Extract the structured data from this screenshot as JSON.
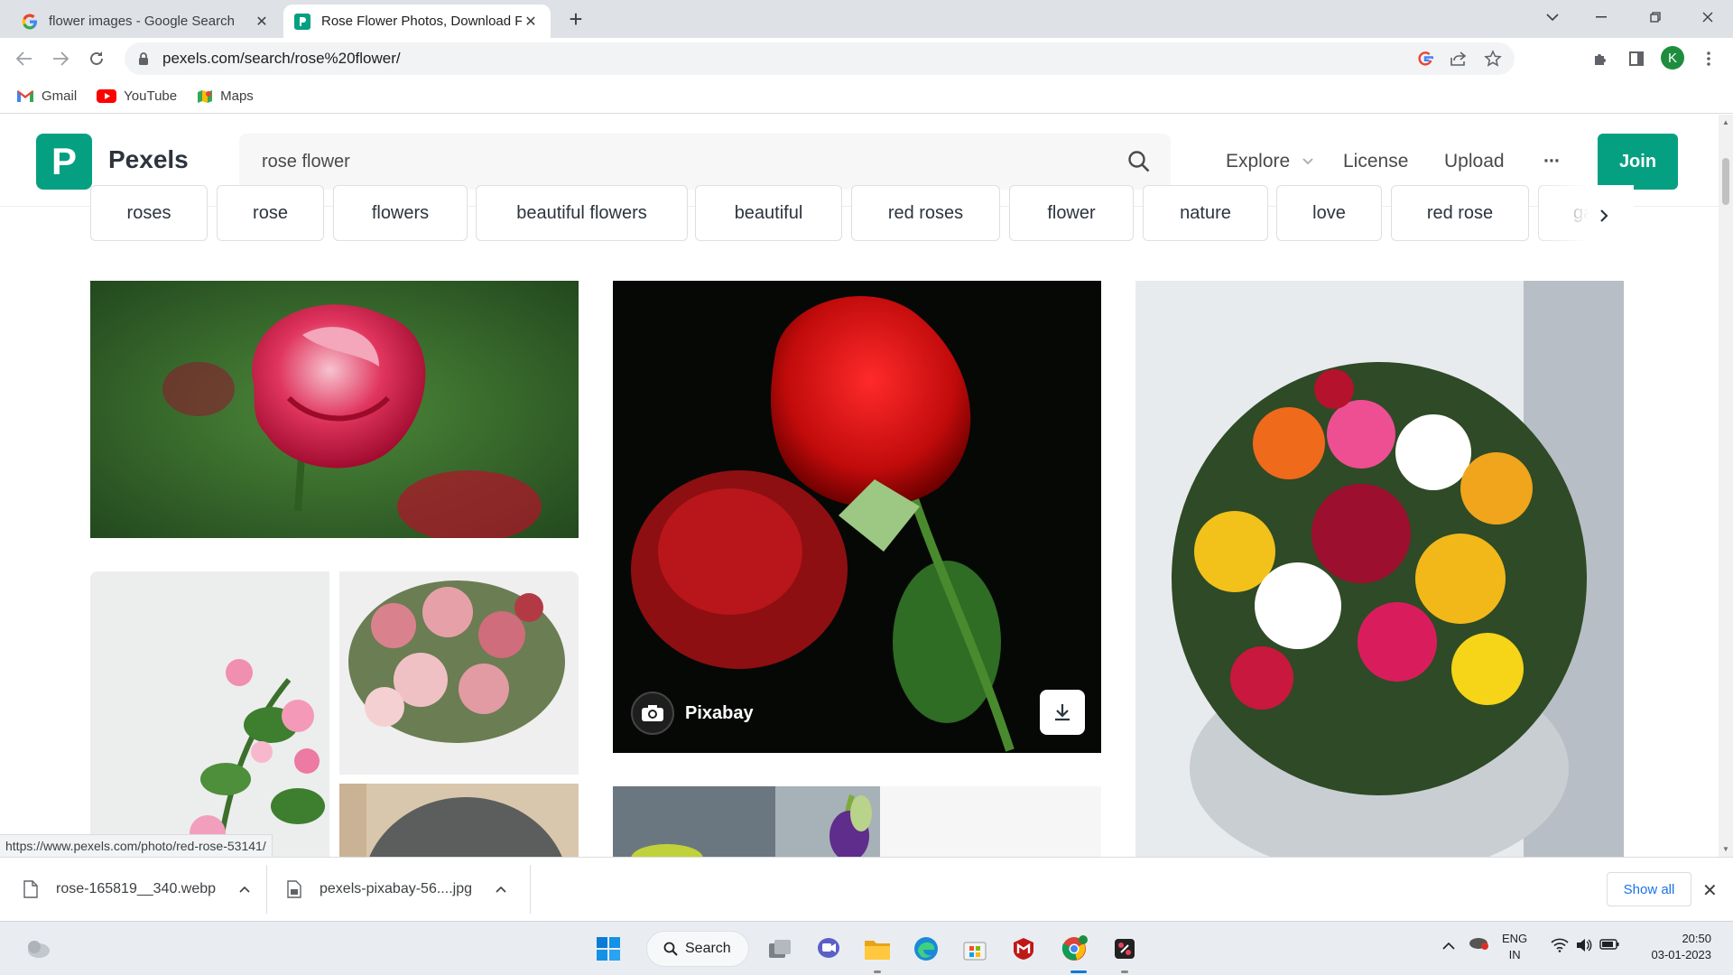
{
  "browser": {
    "tabs": [
      {
        "title": "flower images - Google Search",
        "active": false,
        "favicon": "google-icon"
      },
      {
        "title": "Rose Flower Photos, Download Fr",
        "active": true,
        "favicon": "pexels-icon"
      }
    ],
    "new_tab_label": "+",
    "url": "pexels.com/search/rose%20flower/",
    "profile_initial": "K",
    "bookmarks": [
      {
        "label": "Gmail",
        "icon": "gmail-icon"
      },
      {
        "label": "YouTube",
        "icon": "youtube-icon"
      },
      {
        "label": "Maps",
        "icon": "maps-icon"
      }
    ]
  },
  "pexels": {
    "brand": "Pexels",
    "logo_letter": "P",
    "search_value": "rose flower",
    "nav": {
      "explore": "Explore",
      "license": "License",
      "upload": "Upload",
      "more": "···",
      "join": "Join"
    },
    "tags": [
      "roses",
      "rose",
      "flowers",
      "beautiful flowers",
      "beautiful",
      "red roses",
      "flower",
      "nature",
      "love",
      "red rose",
      "garden"
    ],
    "featured_credit": "Pixabay",
    "featured_credit_avatar": "pixabay",
    "status_url": "https://www.pexels.com/photo/red-rose-53141/"
  },
  "downloads": {
    "items": [
      "rose-165819__340.webp",
      "pexels-pixabay-56....jpg"
    ],
    "show_all": "Show all"
  },
  "taskbar": {
    "search_label": "Search",
    "lang": "ENG",
    "region": "IN",
    "time": "20:50",
    "date": "03-01-2023"
  },
  "colors": {
    "pexels_green": "#05a081",
    "chrome_tabstrip": "#dee1e6",
    "link_blue": "#1a73e8"
  }
}
